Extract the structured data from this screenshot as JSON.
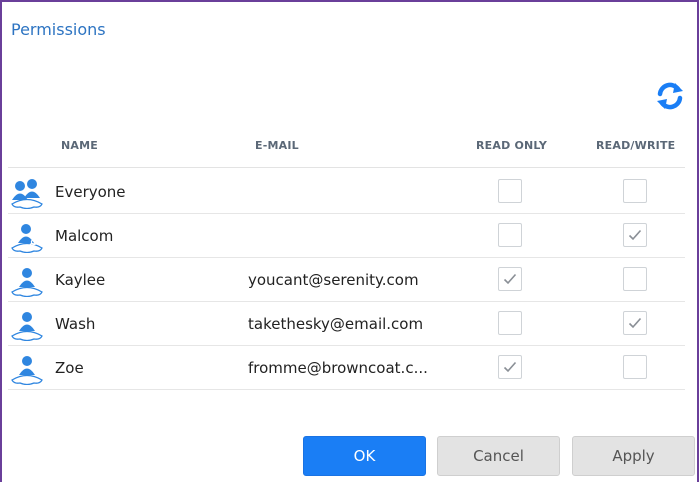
{
  "dialog": {
    "title": "Permissions",
    "refresh_icon": "refresh-icon"
  },
  "columns": {
    "name": "NAME",
    "email": "E-MAIL",
    "read_only": "READ ONLY",
    "read_write": "READ/WRITE"
  },
  "users": [
    {
      "icon": "group-icon",
      "name": "Everyone",
      "email": "",
      "read_only": false,
      "read_write": false
    },
    {
      "icon": "user-key-icon",
      "name": "Malcom",
      "email": "",
      "read_only": false,
      "read_write": true
    },
    {
      "icon": "user-icon",
      "name": "Kaylee",
      "email": "youcant@serenity.com",
      "read_only": true,
      "read_write": false
    },
    {
      "icon": "user-icon",
      "name": "Wash",
      "email": "takethesky@email.com",
      "read_only": false,
      "read_write": true
    },
    {
      "icon": "user-icon",
      "name": "Zoe",
      "email": "fromme@browncoat.c...",
      "read_only": true,
      "read_write": false
    }
  ],
  "buttons": {
    "ok": "OK",
    "cancel": "Cancel",
    "apply": "Apply"
  },
  "colors": {
    "accent": "#1a7ef5",
    "title": "#2d74c2",
    "frame": "#6a3f9a"
  }
}
